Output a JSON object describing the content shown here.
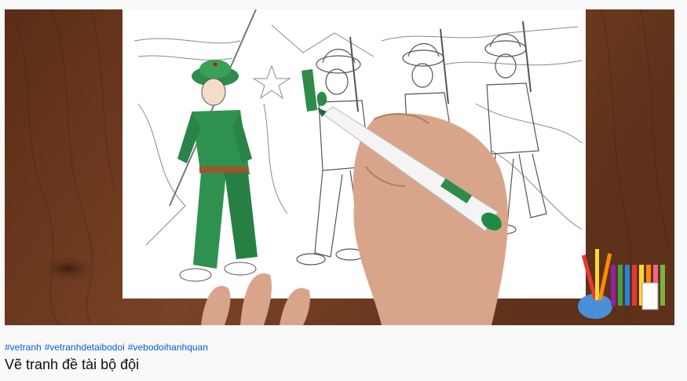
{
  "video": {
    "hashtags": [
      "#vetranh",
      "#vetranhdetaibodoi",
      "#vebodoihanhquan"
    ],
    "title": "Vẽ tranh đề tài bộ đội"
  },
  "colors": {
    "hashtag": "#065fd4",
    "title": "#0f0f0f",
    "page_bg": "#f9f9f9",
    "marker_green": "#2e8b4a"
  },
  "thumbnail": {
    "subject": "hand coloring a drawing of marching soldiers with a green marker",
    "logo_icon": "pencils-and-paint-pot-logo"
  }
}
